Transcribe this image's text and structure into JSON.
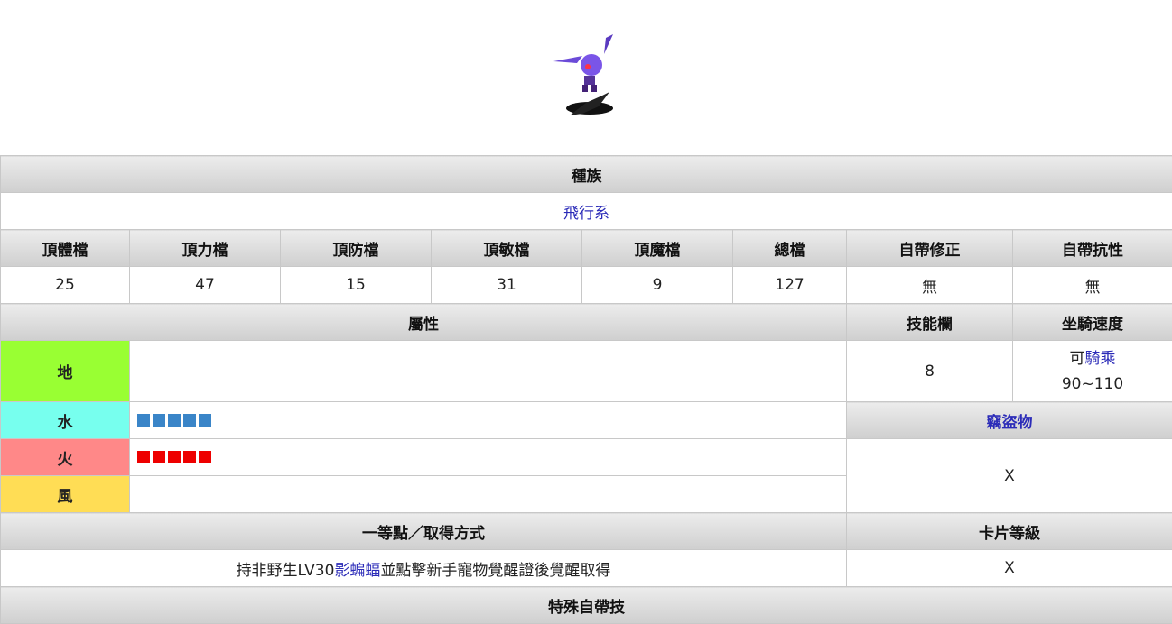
{
  "race": {
    "header": "種族",
    "value": "飛行系"
  },
  "stats": {
    "headers": [
      "頂體檔",
      "頂力檔",
      "頂防檔",
      "頂敏檔",
      "頂魔檔",
      "總檔",
      "自帶修正",
      "自帶抗性"
    ],
    "values": [
      "25",
      "47",
      "15",
      "31",
      "9",
      "127",
      "無",
      "無"
    ]
  },
  "attributes": {
    "header": "屬性",
    "skill_slots_header": "技能欄",
    "mount_speed_header": "坐騎速度",
    "earth": {
      "label": "地",
      "level": 0,
      "color": "#99ff33",
      "bar_color": "#3a7bd5"
    },
    "water": {
      "label": "水",
      "level": 5,
      "color": "#77ffee",
      "bar_color": "#3a85c8"
    },
    "fire": {
      "label": "火",
      "level": 5,
      "color": "#ff8888",
      "bar_color": "#ee0000"
    },
    "wind": {
      "label": "風",
      "level": 0,
      "color": "#ffdd55",
      "bar_color": "#ee0000"
    }
  },
  "skill_slots": "8",
  "mount": {
    "prefix": "可",
    "link": "騎乘",
    "speed": "90~110"
  },
  "steal": {
    "header": "竊盜物",
    "value": "X"
  },
  "acquire": {
    "header": "一等點／取得方式",
    "text_before": "持非野生LV30",
    "link": "影蝙蝠",
    "text_after": "並點擊新手寵物覺醒證後覺醒取得"
  },
  "card": {
    "header": "卡片等級",
    "value": "X"
  },
  "special": {
    "header": "特殊自帶技"
  }
}
